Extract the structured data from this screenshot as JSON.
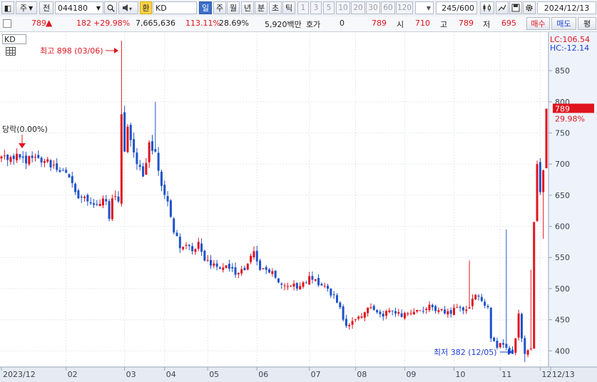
{
  "toolbar": {
    "period_label": "주",
    "prev_label": "전",
    "stock_code": "044180",
    "exchange_label": "환",
    "exchange_value": "KD",
    "timeframes": [
      "일",
      "주",
      "월",
      "년",
      "분",
      "초",
      "틱"
    ],
    "active_timeframe": "일",
    "intervals": [
      "1",
      "3",
      "5",
      "10",
      "20",
      "30",
      "60",
      "120"
    ],
    "count_value": "245",
    "count_total": "/600",
    "date_value": "2024/12/13"
  },
  "quote": {
    "price": "789",
    "arrow": "▲",
    "change": "182",
    "change_pct": "+29.98%",
    "volume": "7,665,636",
    "volume_ratio": "113.11%",
    "turnover": "28.69%",
    "amount": "5,920백만",
    "hoga_label": "호가",
    "hoga_value": "0",
    "price2": "789",
    "open_label": "시",
    "open_value": "710",
    "high_label": "고",
    "high_value": "789",
    "low_label": "저",
    "low_value": "695",
    "buy_label": "매수",
    "sell_label": "매도",
    "extra_label": "평"
  },
  "chart_data": {
    "type": "candlestick",
    "indicator_label": "KD",
    "lc_label": "LC:106.54",
    "hc_label": "HC:-12.14",
    "y_ticks": [
      400,
      450,
      500,
      550,
      600,
      650,
      700,
      750,
      800,
      850
    ],
    "ylim": [
      374,
      912
    ],
    "current_price_label": "789",
    "current_change_label": "29.98%",
    "high_annotation": "최고 898 (03/06)",
    "low_annotation": "최저 382 (12/05)",
    "start_annotation": "당락(0.00%)",
    "x_labels": [
      "2023/12",
      "02",
      "03",
      "04",
      "05",
      "06",
      "07",
      "08",
      "09",
      "10",
      "11",
      "12",
      "12/13"
    ],
    "up_color": "#e0141e",
    "down_color": "#1f53c9",
    "anchors": [
      [
        0,
        712
      ],
      [
        4,
        708
      ],
      [
        14,
        705
      ],
      [
        20,
        690
      ],
      [
        24,
        655
      ],
      [
        28,
        640
      ],
      [
        32,
        636
      ],
      [
        34,
        640
      ],
      [
        35,
        612
      ],
      [
        36,
        645
      ],
      [
        38,
        640
      ],
      [
        39,
        780
      ],
      [
        40,
        720
      ],
      [
        41,
        760
      ],
      [
        44,
        700
      ],
      [
        46,
        680
      ],
      [
        48,
        735
      ],
      [
        50,
        720
      ],
      [
        52,
        665
      ],
      [
        54,
        640
      ],
      [
        56,
        590
      ],
      [
        58,
        565
      ],
      [
        60,
        570
      ],
      [
        62,
        560
      ],
      [
        64,
        575
      ],
      [
        66,
        545
      ],
      [
        68,
        537
      ],
      [
        70,
        535
      ],
      [
        74,
        532
      ],
      [
        77,
        525
      ],
      [
        80,
        540
      ],
      [
        82,
        560
      ],
      [
        84,
        530
      ],
      [
        86,
        530
      ],
      [
        88,
        528
      ],
      [
        90,
        510
      ],
      [
        92,
        505
      ],
      [
        94,
        505
      ],
      [
        96,
        500
      ],
      [
        98,
        510
      ],
      [
        100,
        520
      ],
      [
        102,
        515
      ],
      [
        104,
        505
      ],
      [
        106,
        500
      ],
      [
        108,
        490
      ],
      [
        110,
        470
      ],
      [
        111,
        450
      ],
      [
        112,
        440
      ],
      [
        114,
        448
      ],
      [
        116,
        455
      ],
      [
        118,
        462
      ],
      [
        120,
        470
      ],
      [
        122,
        462
      ],
      [
        124,
        455
      ],
      [
        126,
        465
      ],
      [
        128,
        460
      ],
      [
        132,
        460
      ],
      [
        136,
        465
      ],
      [
        140,
        470
      ],
      [
        144,
        460
      ],
      [
        148,
        470
      ],
      [
        150,
        465
      ],
      [
        152,
        470
      ],
      [
        154,
        490
      ],
      [
        156,
        480
      ],
      [
        158,
        470
      ],
      [
        159,
        420
      ],
      [
        161,
        405
      ],
      [
        163,
        410
      ],
      [
        165,
        400
      ],
      [
        166,
        395
      ],
      [
        167,
        420
      ],
      [
        168,
        460
      ],
      [
        169,
        420
      ],
      [
        170,
        395
      ],
      [
        171,
        401
      ],
      [
        172,
        404
      ],
      [
        173,
        607
      ],
      [
        174,
        700
      ],
      [
        175,
        655
      ],
      [
        176,
        690
      ],
      [
        177,
        789
      ]
    ]
  }
}
